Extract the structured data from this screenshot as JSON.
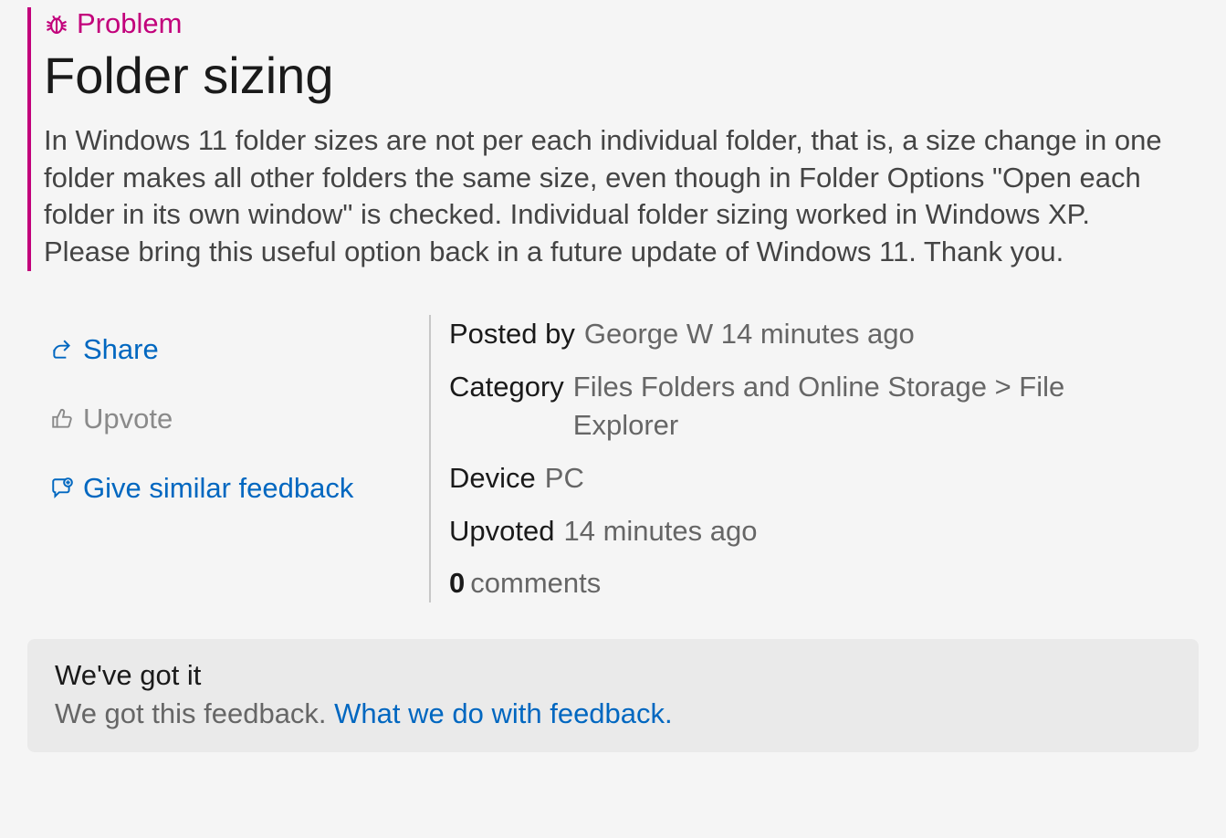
{
  "problem": {
    "tag_label": "Problem",
    "title": "Folder sizing",
    "description": "In Windows 11 folder sizes are not per each individual folder, that is, a size change in one folder makes all other folders the same size, even though in Folder Options \"Open each folder in its own window\" is checked.  Individual folder sizing worked in Windows XP.  Please bring this useful option back in a future update of Windows 11.  Thank you."
  },
  "actions": {
    "share_label": "Share",
    "upvote_label": "Upvote",
    "similar_label": "Give similar feedback"
  },
  "details": {
    "posted_by_label": "Posted by",
    "posted_by_value": "George W 14 minutes ago",
    "category_label": "Category",
    "category_value": "Files Folders and Online Storage > File Explorer",
    "device_label": "Device",
    "device_value": "PC",
    "upvoted_label": "Upvoted",
    "upvoted_value": "14 minutes ago",
    "comments_count": "0",
    "comments_label": "comments"
  },
  "status": {
    "title": "We've got it",
    "body": "We got this feedback.",
    "link_label": "What we do with feedback."
  }
}
